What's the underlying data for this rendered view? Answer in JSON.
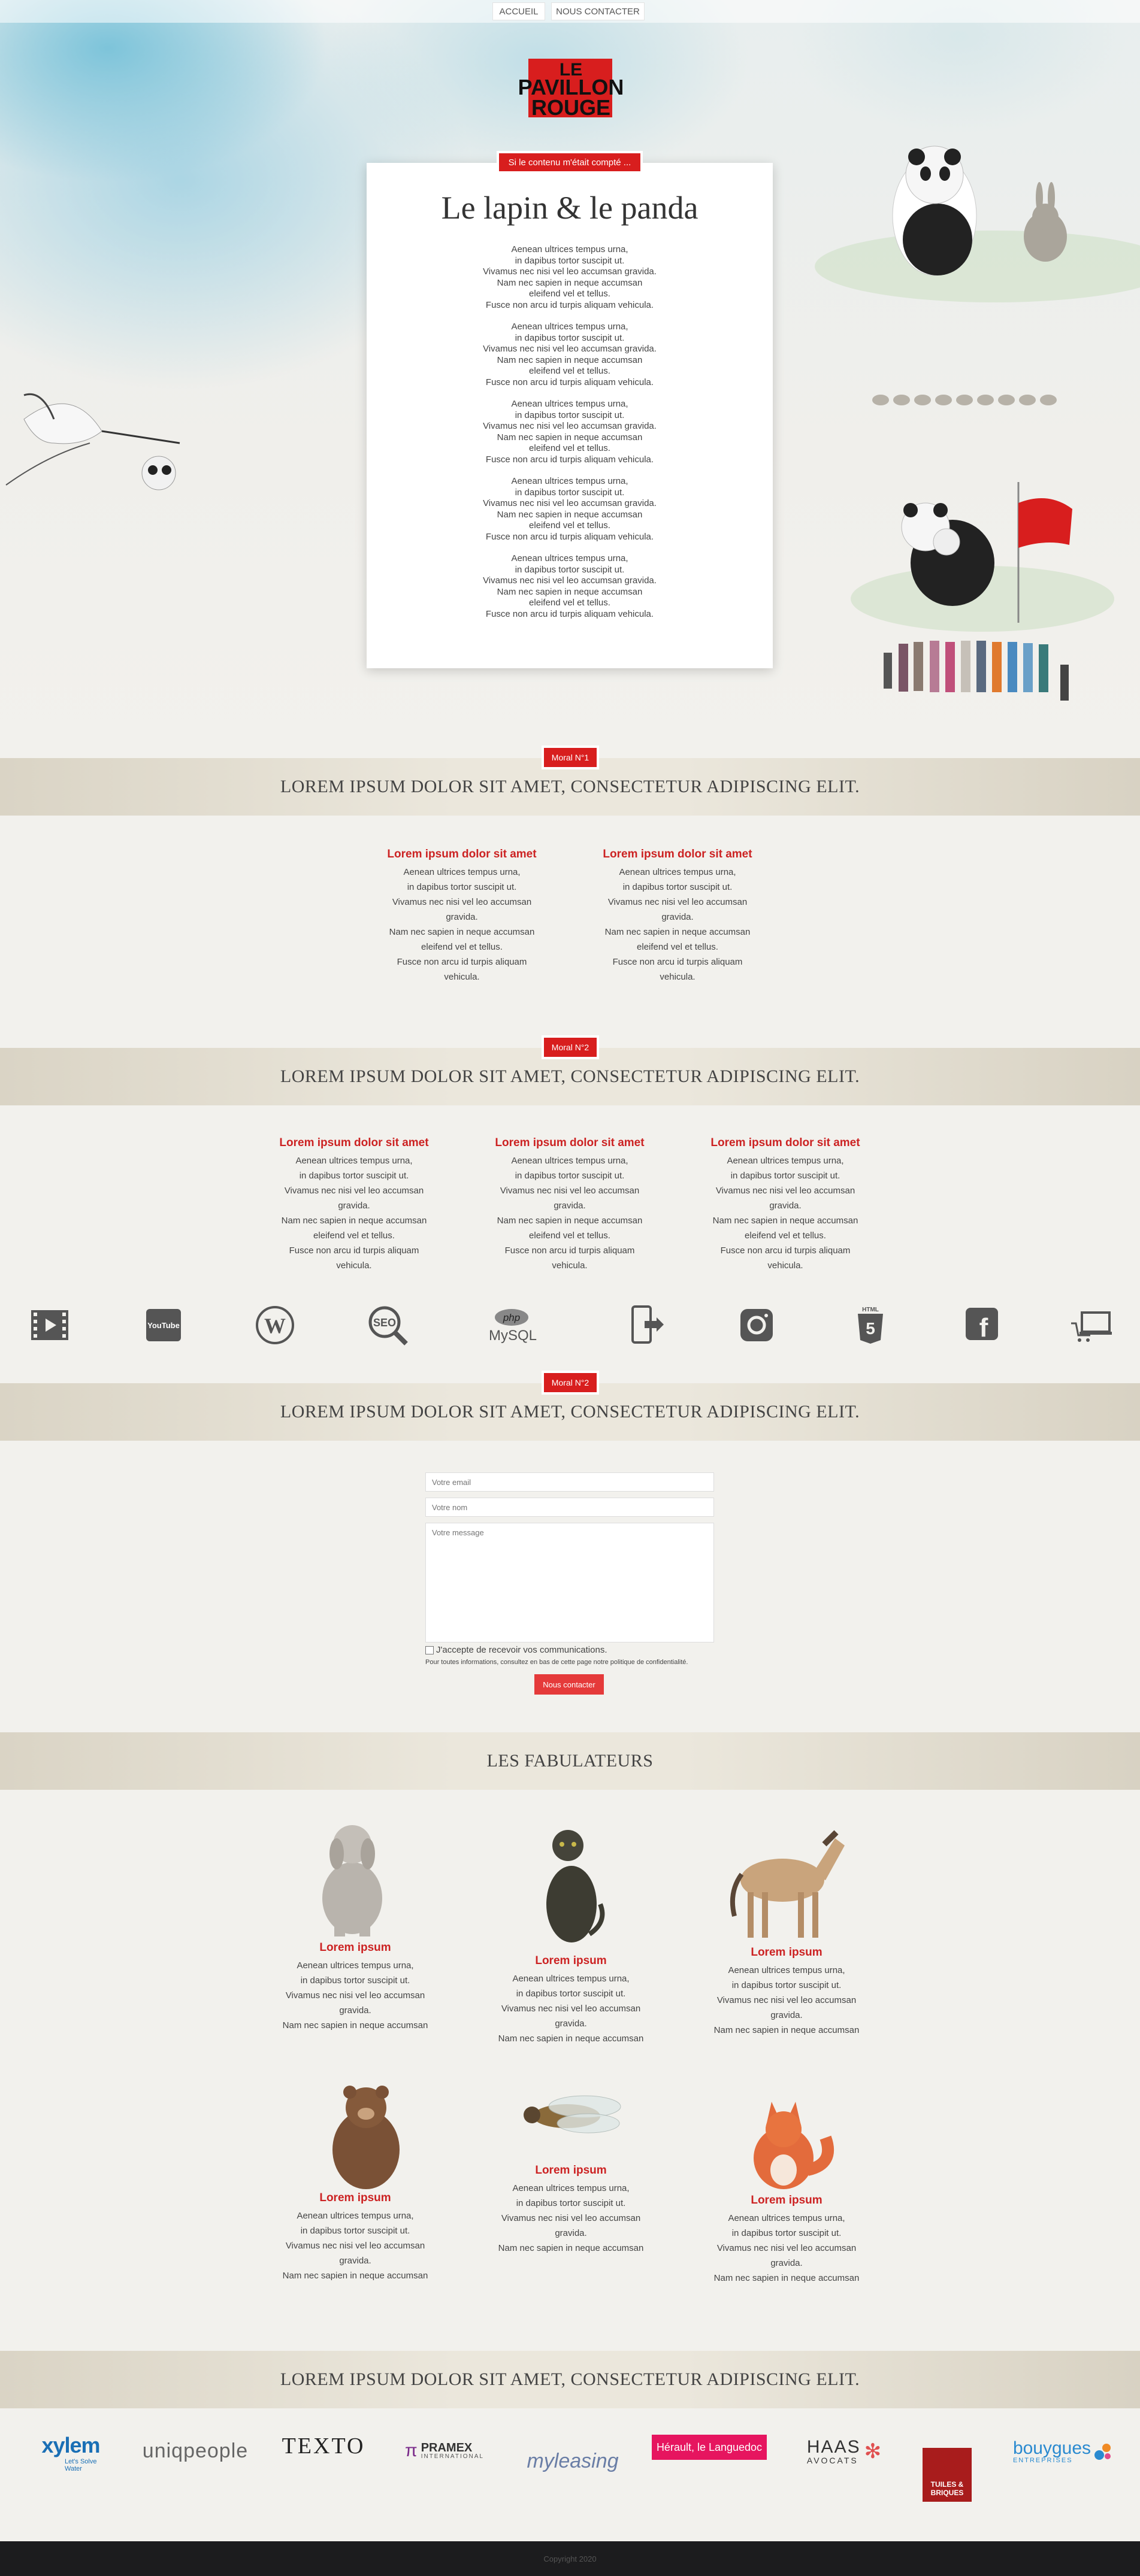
{
  "nav": {
    "home": "ACCUEIL",
    "contact": "NOUS CONTACTER"
  },
  "logo": {
    "line1": "LE",
    "line2": "PAVILLON",
    "line3": "ROUGE",
    "color": "#d81e1e"
  },
  "hero": {
    "badge": "Si le contenu m'était compté ...",
    "title": "Le lapin & le panda",
    "paragraph_lines": [
      "Aenean ultrices tempus urna,",
      "in dapibus tortor suscipit ut.",
      "Vivamus nec nisi vel leo accumsan gravida.",
      "Nam nec sapien in neque accumsan",
      "eleifend vel et tellus.",
      "Fusce non arcu id turpis aliquam vehicula."
    ]
  },
  "moral1": {
    "badge": "Moral N°1",
    "title": "LOREM IPSUM DOLOR SIT AMET, CONSECTETUR ADIPISCING ELIT.",
    "columns": [
      {
        "heading": "Lorem ipsum dolor sit amet",
        "lines": [
          "Aenean ultrices tempus urna,",
          "in dapibus tortor suscipit ut.",
          "Vivamus nec nisi vel leo accumsan",
          "gravida.",
          "Nam nec sapien in neque accumsan",
          "eleifend vel et tellus.",
          "Fusce non arcu id turpis aliquam",
          "vehicula."
        ]
      },
      {
        "heading": "Lorem ipsum dolor sit amet",
        "lines": [
          "Aenean ultrices tempus urna,",
          "in dapibus tortor suscipit ut.",
          "Vivamus nec nisi vel leo accumsan",
          "gravida.",
          "Nam nec sapien in neque accumsan",
          "eleifend vel et tellus.",
          "Fusce non arcu id turpis aliquam",
          "vehicula."
        ]
      }
    ]
  },
  "moral2": {
    "badge": "Moral N°2",
    "title": "LOREM IPSUM DOLOR SIT AMET, CONSECTETUR ADIPISCING ELIT.",
    "columns": [
      {
        "heading": "Lorem ipsum dolor sit amet",
        "lines": [
          "Aenean ultrices tempus urna,",
          "in dapibus tortor suscipit ut.",
          "Vivamus nec nisi vel leo accumsan",
          "gravida.",
          "Nam nec sapien in neque accumsan",
          "eleifend vel et tellus.",
          "Fusce non arcu id turpis aliquam",
          "vehicula."
        ]
      },
      {
        "heading": "Lorem ipsum dolor sit amet",
        "lines": [
          "Aenean ultrices tempus urna,",
          "in dapibus tortor suscipit ut.",
          "Vivamus nec nisi vel leo accumsan",
          "gravida.",
          "Nam nec sapien in neque accumsan",
          "eleifend vel et tellus.",
          "Fusce non arcu id turpis aliquam",
          "vehicula."
        ]
      },
      {
        "heading": "Lorem ipsum dolor sit amet",
        "lines": [
          "Aenean ultrices tempus urna,",
          "in dapibus tortor suscipit ut.",
          "Vivamus nec nisi vel leo accumsan",
          "gravida.",
          "Nam nec sapien in neque accumsan",
          "eleifend vel et tellus.",
          "Fusce non arcu id turpis aliquam",
          "vehicula."
        ]
      }
    ]
  },
  "tech_icons": {
    "video": "video-icon",
    "youtube": "YouTube",
    "wordpress": "wordpress-icon",
    "seo": "SEO",
    "php": "php",
    "mysql": "MySQL",
    "mobile": "mobile-icon",
    "instagram": "instagram-icon",
    "html5": "HTML",
    "facebook": "f",
    "ecommerce": "ecommerce-icon"
  },
  "moral3": {
    "badge": "Moral N°2",
    "title": "LOREM IPSUM DOLOR SIT AMET, CONSECTETUR ADIPISCING ELIT."
  },
  "form": {
    "email_placeholder": "Votre email",
    "name_placeholder": "Votre nom",
    "message_placeholder": "Votre message",
    "consent": "J'accepte de recevoir vos communications.",
    "privacy": "Pour toutes informations, consultez en bas de cette page notre politique de confidentialité.",
    "submit": "Nous contacter"
  },
  "team": {
    "title": "LES FABULATEURS",
    "members": [
      {
        "name": "Lorem ipsum",
        "lines": [
          "Aenean ultrices tempus urna,",
          "in dapibus tortor suscipit ut.",
          "Vivamus nec nisi vel leo accumsan",
          "gravida.",
          "Nam nec sapien in neque accumsan"
        ]
      },
      {
        "name": "Lorem ipsum",
        "lines": [
          "Aenean ultrices tempus urna,",
          "in dapibus tortor suscipit ut.",
          "Vivamus nec nisi vel leo accumsan",
          "gravida.",
          "Nam nec sapien in neque accumsan"
        ]
      },
      {
        "name": "Lorem ipsum",
        "lines": [
          "Aenean ultrices tempus urna,",
          "in dapibus tortor suscipit ut.",
          "Vivamus nec nisi vel leo accumsan",
          "gravida.",
          "Nam nec sapien in neque accumsan"
        ]
      },
      {
        "name": "Lorem ipsum",
        "lines": [
          "Aenean ultrices tempus urna,",
          "in dapibus tortor suscipit ut.",
          "Vivamus nec nisi vel leo accumsan",
          "gravida.",
          "Nam nec sapien in neque accumsan"
        ]
      },
      {
        "name": "Lorem ipsum",
        "lines": [
          "Aenean ultrices tempus urna,",
          "in dapibus tortor suscipit ut.",
          "Vivamus nec nisi vel leo accumsan",
          "gravida.",
          "Nam nec sapien in neque accumsan"
        ]
      },
      {
        "name": "Lorem ipsum",
        "lines": [
          "Aenean ultrices tempus urna,",
          "in dapibus tortor suscipit ut.",
          "Vivamus nec nisi vel leo accumsan",
          "gravida.",
          "Nam nec sapien in neque accumsan"
        ]
      }
    ]
  },
  "clients": {
    "title": "LOREM IPSUM DOLOR SIT AMET, CONSECTETUR ADIPISCING ELIT.",
    "xylem": "xylem",
    "xylem_tag": "Let's Solve Water",
    "uniqpeople": "uniqpeople",
    "texto": "TEXTO",
    "pramex": "PRAMEX",
    "pramex_sub": "INTERNATIONAL",
    "myleasing": "myleasing",
    "herault": "Hérault, le Languedoc",
    "haas": "HAAS",
    "haas_sub": "AVOCATS",
    "tuiles_1": "TUILES &",
    "tuiles_2": "BRIQUES",
    "bouygues": "bouygues",
    "bouygues_sub": "ENTREPRISES"
  },
  "footer": {
    "copyright": "Copyright 2020"
  },
  "colors": {
    "accent": "#d81e1e",
    "heading_red": "#cc2222",
    "footer_bg": "#1c1c1e"
  }
}
